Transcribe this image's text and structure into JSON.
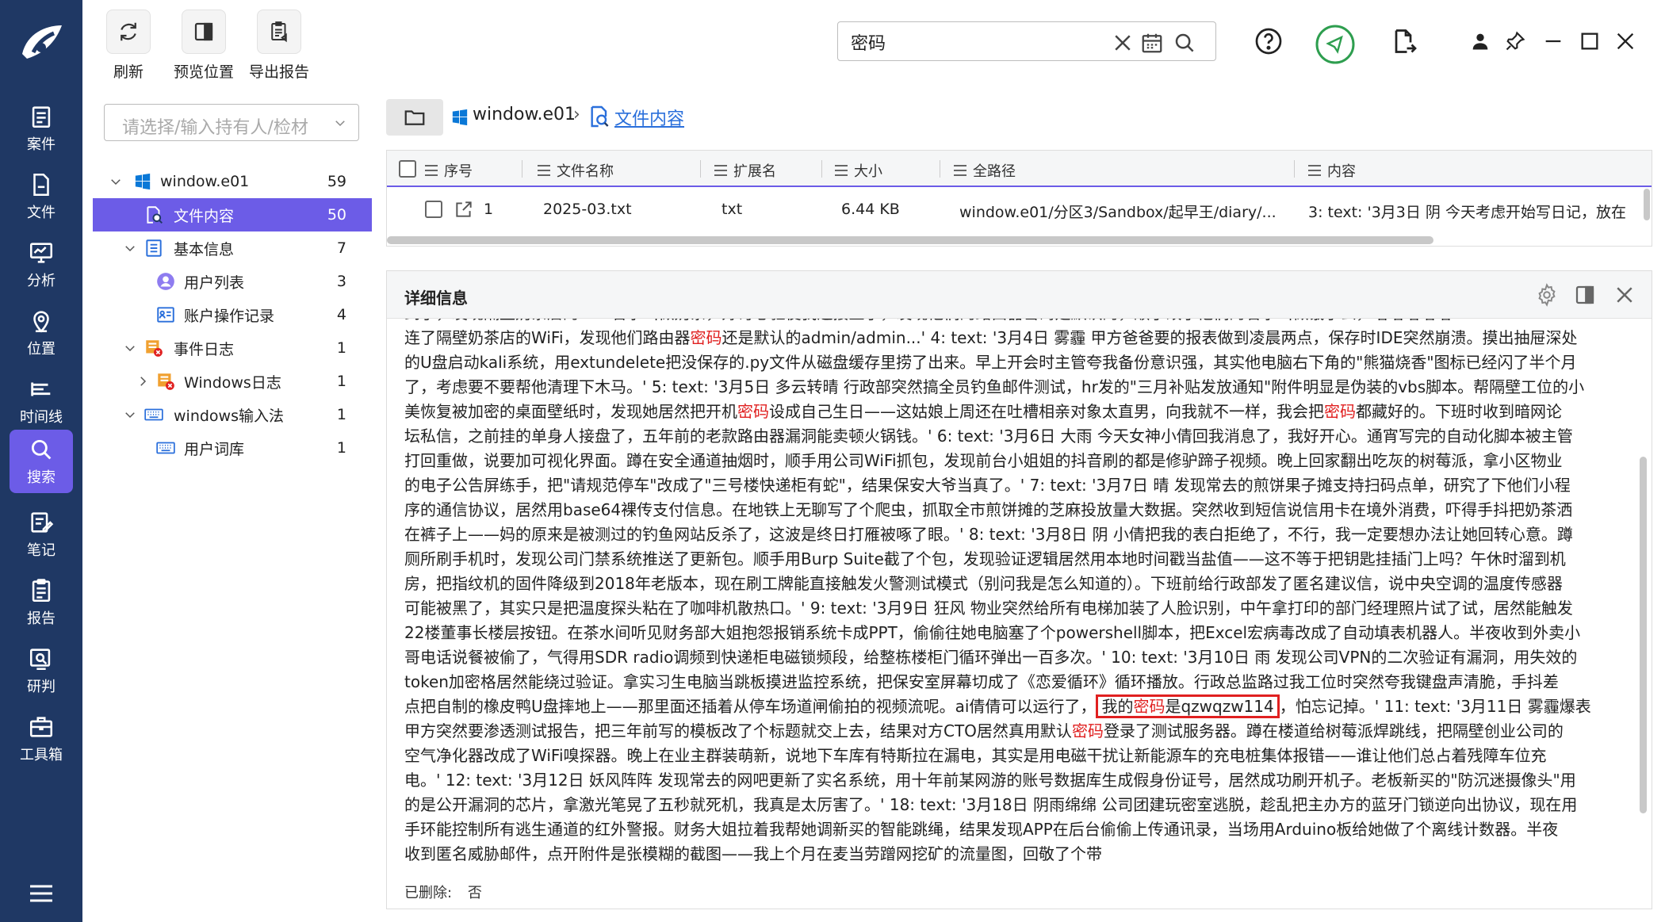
{
  "toolbar": {
    "refresh": "刷新",
    "preview": "预览位置",
    "export": "导出报告"
  },
  "search": {
    "value": "密码"
  },
  "nav": {
    "items": [
      "案件",
      "文件",
      "分析",
      "位置",
      "时间线",
      "搜索",
      "笔记",
      "报告",
      "研判",
      "工具箱"
    ],
    "active": "搜索"
  },
  "sidebar": {
    "holder_placeholder": "请选择/输入持有人/检材",
    "tree": [
      {
        "label": "window.e01",
        "count": "59"
      },
      {
        "label": "文件内容",
        "count": "50"
      },
      {
        "label": "基本信息",
        "count": "7"
      },
      {
        "label": "用户列表",
        "count": "3"
      },
      {
        "label": "账户操作记录",
        "count": "4"
      },
      {
        "label": "事件日志",
        "count": "1"
      },
      {
        "label": "Windows日志",
        "count": "1"
      },
      {
        "label": "windows输入法",
        "count": "1"
      },
      {
        "label": "用户词库",
        "count": "1"
      }
    ]
  },
  "breadcrumb": {
    "root": "window.e01",
    "sep": "›",
    "current": "文件内容"
  },
  "table": {
    "columns": [
      "序号",
      "文件名称",
      "扩展名",
      "大小",
      "全路径",
      "内容"
    ],
    "rows": [
      {
        "index": "1",
        "name": "2025-03.txt",
        "ext": "txt",
        "size": "6.44 KB",
        "path": "window.e01/分区3/Sandbox/起早王/diary/...",
        "content": "3: text: '3月3日 阴 今天考虑开始写日记，放在"
      }
    ]
  },
  "detail": {
    "title": "详细信息",
    "lines": [
      "到了，发现隔壁奶茶店的WiFi名字叫做奶茶，好奇心驱使我连接上了，发现他们的路由器密码是默认的，顺手改了他们的名字叫做饿了么，嘻嘻嘻嘻嘻",
      "连了隔壁奶茶店的WiFi，发现他们路由器|密码|还是默认的admin/admin...' 4: text: '3月4日 雾霾 甲方爸爸要的报表做到凌晨两点，保存时IDE突然崩溃。摸出抽屉深处",
      "的U盘启动kali系统，用extundelete把没保存的.py文件从磁盘缓存里捞了出来。早上开会时主管夸我备份意识强，其实他电脑右下角的\"熊猫烧香\"图标已经闪了半个月",
      "了，考虑要不要帮他清理下木马。' 5: text: '3月5日 多云转晴 行政部突然搞全员钓鱼邮件测试，hr发的\"三月补贴发放通知\"附件明显是伪装的vbs脚本。帮隔壁工位的小",
      "美恢复被加密的桌面壁纸时，发现她居然把开机|密码|设成自己生日——这姑娘上周还在吐槽相亲对象太直男，向我就不一样，我会把|密码|都藏好的。下班时收到暗网论",
      "坛私信，之前挂的单身人接盘了，五年前的老款路由器漏洞能卖顿火锅钱。' 6: text: '3月6日 大雨 今天女神小倩回我消息了，我好开心。通宵写完的自动化脚本被主管",
      "打回重做，说要加可视化界面。蹲在安全通道抽烟时，顺手用公司WiFi抓包，发现前台小姐姐的抖音刷的都是修驴蹄子视频。晚上回家翻出吃灰的树莓派，拿小区物业",
      "的电子公告屏练手，把\"请规范停车\"改成了\"三号楼快递柜有蛇\"，结果保安大爷当真了。' 7: text: '3月7日 晴 发现常去的煎饼果子摊支持扫码点单，研究了下他们小程",
      "序的通信协议，居然用base64裸传支付信息。在地铁上无聊写了个爬虫，抓取全市煎饼摊的芝麻投放量大数据。突然收到短信说信用卡在境外消费，吓得手抖把奶茶洒",
      "在裤子上——妈的原来是被测过的钓鱼网站反杀了，这波是终日打雁被啄了眼。' 8: text: '3月8日 阴 小倩把我的表白拒绝了，不行，我一定要想办法让她回转心意。蹲",
      "厕所刷手机时，发现公司门禁系统推送了更新包。顺手用Burp Suite截了个包，发现验证逻辑居然用本地时间戳当盐值——这不等于把钥匙挂插门上吗？午休时溜到机",
      "房，把指纹机的固件降级到2018年老版本，现在刷工牌能直接触发火警测试模式（别问我是怎么知道的）。下班前给行政部发了匿名建议信，说中央空调的温度传感器",
      "可能被黑了，其实只是把温度探头粘在了咖啡机散热口。' 9: text: '3月9日 狂风 物业突然给所有电梯加装了人脸识别，中午拿打印的部门经理照片试了试，居然能触发",
      "22楼董事长楼层按钮。在茶水间听见财务部大姐抱怨报销系统卡成PPT，偷偷往她电脑塞了个powershell脚本，把Excel宏病毒改成了自动填表机器人。半夜收到外卖小",
      "哥电话说餐被偷了，气得用SDR radio调频到快递柜电磁锁频段，给整栋楼柜门循环弹出一百多次。' 10: text: '3月10日 雨 发现公司VPN的二次验证有漏洞，用失效的",
      "token加密格居然能绕过验证。拿实习生电脑当跳板摸进监控系统，把保安室屏幕切成了《恋爱循环》循环播放。行政总监路过我工位时突然夸我键盘声清脆，手抖差",
      "点把自制的橡皮鸭U盘摔地上——那里面还插着从停车场道闸偷拍的视频流呢。ai倩倩可以运行了，[我的|密码|是qzwqzw114]，怕忘记掉。' 11: text: '3月11日 雾霾爆表",
      "甲方突然要渗透测试报告，把三年前写的模板改了个标题就交上去，结果对方CTO居然真用默认|密码|登录了测试服务器。蹲在楼道给树莓派焊跳线，把隔壁创业公司的",
      "空气净化器改成了WiFi嗅探器。晚上在业主群装萌新，说地下车库有特斯拉在漏电，其实是用电磁干扰让新能源车的充电桩集体报错——谁让他们总占着残障车位充",
      "电。' 12: text: '3月12日 妖风阵阵 发现常去的网吧更新了实名系统，用十年前某网游的账号数据库生成假身份证号，居然成功刷开机子。老板新买的\"防沉迷摄像头\"用",
      "的是公开漏洞的芯片，拿激光笔晃了五秒就死机，我真是太厉害了。' 18: text: '3月18日 阴雨绵绵 公司团建玩密室逃脱，趁乱把主办方的蓝牙门锁逆向出协议，现在用",
      "手环能控制所有逃生通道的红外警报。财务大姐拉着我帮她调新买的智能跳绳，结果发现APP在后台偷偷上传通讯录，当场用Arduino板给她做了个离线计数器。半夜",
      "收到匿名威胁邮件，点开附件是张模糊的截图——我上个月在麦当劳蹭网挖矿的流量图，回敬了个带"
    ],
    "deleted_label": "已删除:",
    "deleted_value": "否"
  }
}
